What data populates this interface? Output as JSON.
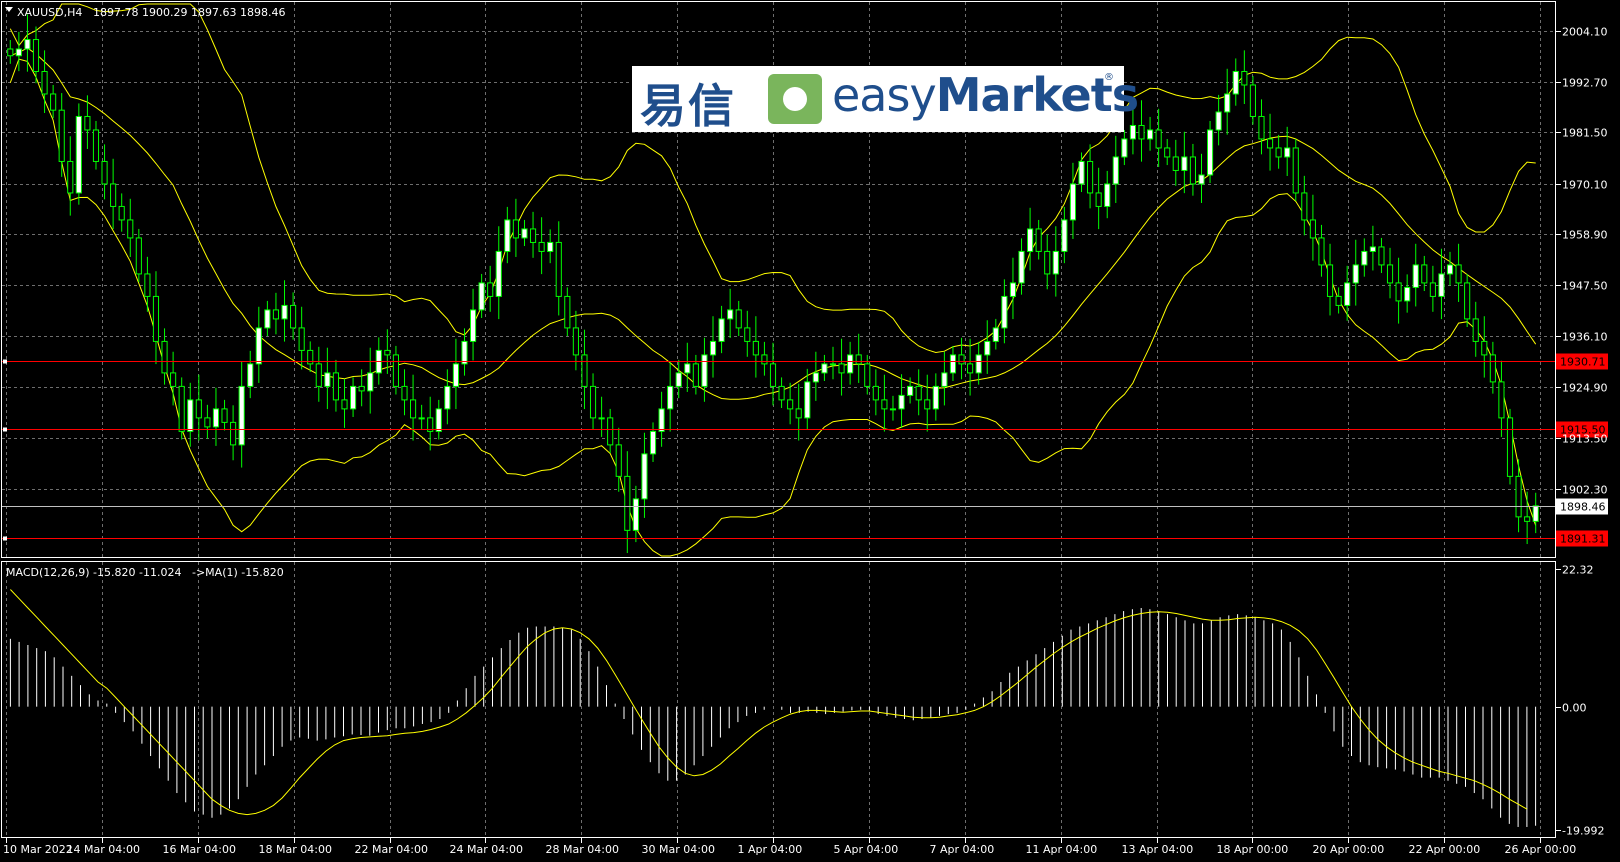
{
  "header": {
    "symbol_timeframe": "XAUUSD,H4",
    "ohlc": "1897.78 1900.29 1897.63 1898.46",
    "indicator_label": "MACD(12,26,9) -15.820 -11.024",
    "indicator_ma_label": "->MA(1) -15.820"
  },
  "logo": {
    "cn": "易信",
    "en_light": "easy",
    "en_bold": "Markets",
    "reg": "®"
  },
  "colors": {
    "background": "#000000",
    "grid": "#6e6e6e",
    "bullish": "#00ff00",
    "bullish_body": "#ffffff",
    "bands": "#ffff00",
    "level_line": "#ff0000",
    "current_price": "#c0c0c0",
    "histogram": "#ffffff",
    "signal": "#ffff00"
  },
  "chart_data": [
    {
      "type": "candlestick",
      "symbol": "XAUUSD",
      "timeframe": "H4",
      "y_ticks": [
        "2004.10",
        "1992.70",
        "1981.50",
        "1970.10",
        "1958.90",
        "1947.50",
        "1936.10",
        "1924.90",
        "1913.50",
        "1902.30"
      ],
      "ylim": [
        1887.3,
        2010.0
      ],
      "x_ticks": [
        "10 Mar 2022",
        "14 Mar 04:00",
        "16 Mar 04:00",
        "18 Mar 04:00",
        "22 Mar 04:00",
        "24 Mar 04:00",
        "28 Mar 04:00",
        "30 Mar 04:00",
        "1 Apr 04:00",
        "5 Apr 04:00",
        "7 Apr 04:00",
        "11 Apr 04:00",
        "13 Apr 04:00",
        "18 Apr 00:00",
        "20 Apr 00:00",
        "22 Apr 00:00",
        "26 Apr 00:00"
      ],
      "levels": [
        {
          "price": 1930.71,
          "label": "1930.71",
          "color": "#ff0000"
        },
        {
          "price": 1915.5,
          "label": "1915.50",
          "color": "#ff0000"
        },
        {
          "price": 1891.31,
          "label": "1891.31",
          "color": "#ff0000"
        }
      ],
      "current_price": {
        "price": 1898.46,
        "label": "1898.46"
      },
      "closes": [
        1998.5,
        2000.0,
        2002.1,
        1995.0,
        1990.0,
        1986.4,
        1975.0,
        1968.0,
        1985.0,
        1982.0,
        1975.0,
        1970.0,
        1965.0,
        1962.0,
        1958.0,
        1950.0,
        1945.0,
        1935.0,
        1928.0,
        1925.0,
        1915.0,
        1922.0,
        1918.0,
        1916.0,
        1920.0,
        1917.0,
        1912.0,
        1925.0,
        1930.0,
        1938.0,
        1942.0,
        1940.0,
        1943.0,
        1938.0,
        1933.0,
        1930.0,
        1925.0,
        1928.0,
        1922.0,
        1920.0,
        1925.0,
        1924.0,
        1928.0,
        1933.0,
        1932.0,
        1925.0,
        1922.0,
        1918.0,
        1918.0,
        1915.0,
        1920.0,
        1925.0,
        1930.0,
        1935.0,
        1942.0,
        1948.0,
        1945.0,
        1955.0,
        1962.0,
        1958.0,
        1960.0,
        1957.0,
        1955.0,
        1957.0,
        1945.0,
        1938.0,
        1932.0,
        1925.0,
        1918.0,
        1918.0,
        1912.0,
        1905.0,
        1893.0,
        1900.0,
        1910.0,
        1915.0,
        1920.0,
        1925.0,
        1928.0,
        1930.0,
        1925.0,
        1932.0,
        1935.0,
        1940.0,
        1942.0,
        1938.0,
        1935.0,
        1932.0,
        1930.0,
        1925.0,
        1922.0,
        1920.0,
        1918.0,
        1926.0,
        1928.0,
        1930.0,
        1930.0,
        1928.0,
        1932.0,
        1930.0,
        1925.0,
        1922.0,
        1920.0,
        1920.0,
        1923.0,
        1925.0,
        1922.0,
        1920.0,
        1925.0,
        1928.0,
        1932.0,
        1930.0,
        1928.0,
        1932.0,
        1935.0,
        1938.0,
        1945.0,
        1948.0,
        1955.0,
        1960.0,
        1955.0,
        1950.0,
        1955.0,
        1962.0,
        1970.0,
        1975.0,
        1968.0,
        1965.0,
        1970.0,
        1976.0,
        1980.0,
        1983.0,
        1980.0,
        1982.0,
        1978.0,
        1976.0,
        1973.0,
        1976.0,
        1970.0,
        1972.0,
        1982.0,
        1986.0,
        1990.0,
        1995.0,
        1992.0,
        1985.0,
        1980.0,
        1978.0,
        1976.0,
        1978.0,
        1968.0,
        1962.0,
        1958.0,
        1952.0,
        1945.0,
        1943.0,
        1948.0,
        1952.0,
        1955.0,
        1956.0,
        1952.0,
        1948.0,
        1944.0,
        1947.0,
        1952.0,
        1948.0,
        1945.0,
        1950.0,
        1952.0,
        1948.0,
        1940.0,
        1935.0,
        1932.0,
        1926.0,
        1918.0,
        1905.0,
        1896.0,
        1895.0,
        1898.46
      ]
    },
    {
      "type": "macd",
      "params": "12,26,9",
      "y_ticks": [
        "22.32",
        "0.00",
        "-19.992"
      ],
      "ylim": [
        -19.992,
        22.32
      ],
      "histogram": [
        11.0,
        10.5,
        10.0,
        9.5,
        9.0,
        8.0,
        6.5,
        5.0,
        3.5,
        2.0,
        1.0,
        0.5,
        -1.0,
        -2.5,
        -4.0,
        -6.0,
        -8.0,
        -10.0,
        -12.0,
        -14.0,
        -15.5,
        -17.0,
        -17.5,
        -18.0,
        -17.5,
        -16.5,
        -15.0,
        -13.0,
        -11.0,
        -9.5,
        -8.0,
        -6.5,
        -5.5,
        -5.0,
        -5.2,
        -5.5,
        -5.3,
        -5.0,
        -4.8,
        -4.5,
        -4.6,
        -4.7,
        -4.2,
        -3.8,
        -3.5,
        -3.5,
        -3.2,
        -2.8,
        -2.5,
        -2.0,
        -1.0,
        1.0,
        3.0,
        5.0,
        6.5,
        8.0,
        9.5,
        10.8,
        12.0,
        12.8,
        13.0,
        13.0,
        13.0,
        12.8,
        12.5,
        11.0,
        9.0,
        6.5,
        3.5,
        0.5,
        -2.0,
        -4.5,
        -7.0,
        -9.0,
        -10.8,
        -12.0,
        -12.0,
        -11.0,
        -9.5,
        -8.0,
        -6.5,
        -5.0,
        -3.5,
        -2.5,
        -1.5,
        -1.0,
        -0.5,
        0.0,
        -0.5,
        -1.0,
        -1.0,
        -0.8,
        -1.0,
        -1.2,
        -1.0,
        -0.8,
        -0.6,
        -0.5,
        -0.8,
        -1.2,
        -1.5,
        -1.8,
        -2.0,
        -2.2,
        -2.0,
        -1.8,
        -1.5,
        -1.2,
        -1.0,
        -0.5,
        0.5,
        1.5,
        2.5,
        4.0,
        5.5,
        6.5,
        7.5,
        8.5,
        9.5,
        10.5,
        11.5,
        12.5,
        13.0,
        13.5,
        14.0,
        14.5,
        15.0,
        15.5,
        15.8,
        16.0,
        15.8,
        15.5,
        15.0,
        14.5,
        14.0,
        13.5,
        13.5,
        14.0,
        14.5,
        14.8,
        15.0,
        14.8,
        14.5,
        14.0,
        13.5,
        12.5,
        10.5,
        8.0,
        5.0,
        2.0,
        -1.0,
        -4.0,
        -6.5,
        -8.0,
        -9.0,
        -9.5,
        -9.8,
        -10.0,
        -10.2,
        -10.5,
        -11.0,
        -11.5,
        -11.5,
        -11.5,
        -12.0,
        -12.5,
        -13.0,
        -14.0,
        -15.0,
        -16.5,
        -18.0,
        -19.0,
        -19.5,
        -19.5,
        -19.3
      ],
      "signal": [
        19.0,
        17.5,
        16.0,
        14.5,
        13.0,
        11.5,
        10.0,
        8.5,
        7.0,
        5.5,
        4.0,
        3.0,
        1.5,
        0.0,
        -1.5,
        -3.0,
        -4.5,
        -6.0,
        -7.5,
        -9.0,
        -10.5,
        -12.0,
        -13.5,
        -15.0,
        -16.0,
        -16.8,
        -17.3,
        -17.5,
        -17.3,
        -16.8,
        -16.0,
        -14.8,
        -13.2,
        -11.5,
        -10.0,
        -8.5,
        -7.2,
        -6.2,
        -5.5,
        -5.2,
        -5.0,
        -4.9,
        -4.8,
        -4.7,
        -4.5,
        -4.3,
        -4.2,
        -4.0,
        -3.7,
        -3.3,
        -2.8,
        -2.0,
        -1.0,
        0.2,
        1.5,
        3.0,
        4.8,
        6.5,
        8.2,
        9.8,
        11.0,
        12.0,
        12.6,
        12.8,
        12.6,
        12.0,
        11.0,
        9.5,
        7.5,
        5.2,
        2.8,
        0.4,
        -2.0,
        -4.3,
        -6.5,
        -8.3,
        -9.8,
        -10.8,
        -11.2,
        -11.0,
        -10.3,
        -9.3,
        -8.0,
        -6.8,
        -5.5,
        -4.3,
        -3.3,
        -2.5,
        -1.8,
        -1.2,
        -0.8,
        -0.6,
        -0.6,
        -0.7,
        -0.8,
        -0.9,
        -0.8,
        -0.7,
        -0.7,
        -0.9,
        -1.1,
        -1.3,
        -1.5,
        -1.7,
        -1.8,
        -1.8,
        -1.7,
        -1.5,
        -1.3,
        -1.0,
        -0.6,
        0.0,
        0.8,
        1.8,
        2.9,
        4.0,
        5.2,
        6.4,
        7.5,
        8.6,
        9.6,
        10.5,
        11.3,
        12.0,
        12.7,
        13.3,
        13.9,
        14.4,
        14.8,
        15.1,
        15.3,
        15.4,
        15.3,
        15.1,
        14.8,
        14.5,
        14.2,
        14.0,
        14.0,
        14.1,
        14.3,
        14.4,
        14.5,
        14.4,
        14.2,
        13.8,
        13.2,
        12.3,
        11.0,
        9.2,
        7.0,
        4.7,
        2.3,
        0.0,
        -2.0,
        -3.8,
        -5.3,
        -6.5,
        -7.5,
        -8.3,
        -9.0,
        -9.5,
        -10.0,
        -10.5,
        -10.8,
        -11.2,
        -11.6,
        -12.0,
        -12.6,
        -13.3,
        -14.1,
        -15.0,
        -15.8,
        -16.6
      ]
    }
  ]
}
